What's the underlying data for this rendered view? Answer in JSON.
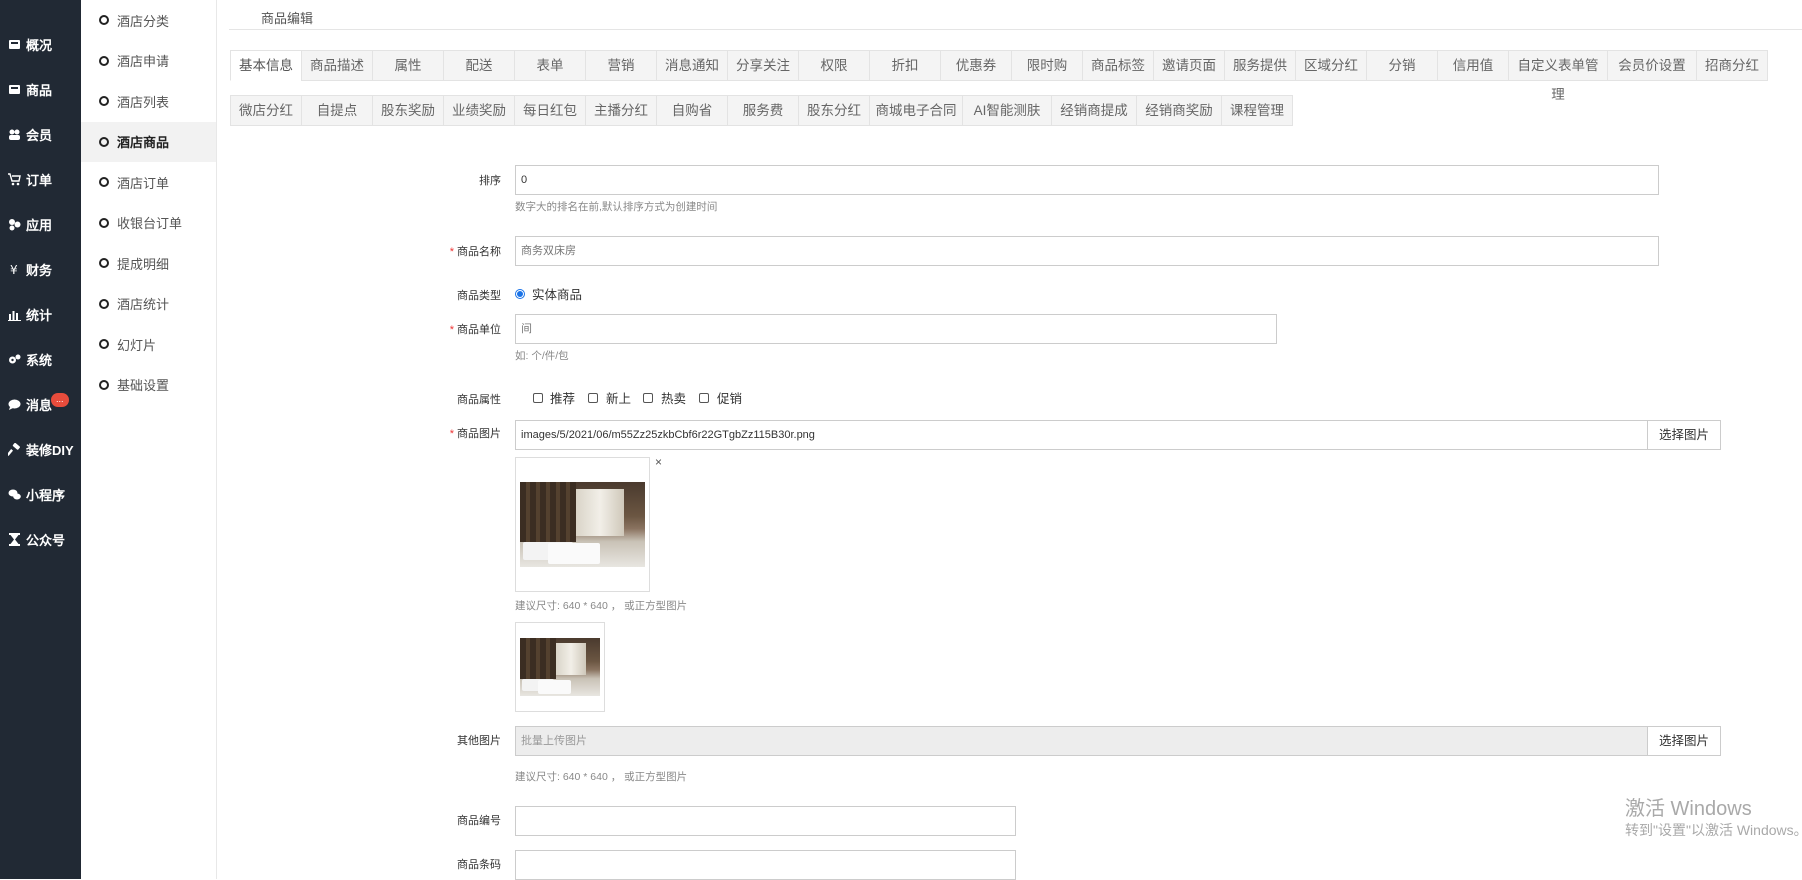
{
  "nav": {
    "items": [
      {
        "label": "概况",
        "icon": "dashboard-icon"
      },
      {
        "label": "商品",
        "icon": "product-icon"
      },
      {
        "label": "会员",
        "icon": "users-icon"
      },
      {
        "label": "订单",
        "icon": "cart-icon"
      },
      {
        "label": "应用",
        "icon": "apps-icon"
      },
      {
        "label": "财务",
        "icon": "yen-icon"
      },
      {
        "label": "统计",
        "icon": "bar-chart-icon"
      },
      {
        "label": "系统",
        "icon": "gears-icon"
      },
      {
        "label": "消息",
        "icon": "chat-icon",
        "badge": "..."
      },
      {
        "label": "装修DIY",
        "icon": "hammer-icon"
      },
      {
        "label": "小程序",
        "icon": "wechat-icon"
      },
      {
        "label": "公众号",
        "icon": "hourglass-icon"
      }
    ]
  },
  "subnav": {
    "items": [
      "酒店分类",
      "酒店申请",
      "酒店列表",
      "酒店商品",
      "酒店订单",
      "收银台订单",
      "提成明细",
      "酒店统计",
      "幻灯片",
      "基础设置"
    ],
    "active_index": 3
  },
  "page": {
    "title": "商品编辑"
  },
  "tabs": {
    "row1": [
      "基本信息",
      "商品描述",
      "属性",
      "配送",
      "表单",
      "营销",
      "消息通知",
      "分享关注",
      "权限",
      "折扣",
      "优惠券",
      "限时购",
      "商品标签",
      "邀请页面",
      "服务提供",
      "区域分红",
      "分销",
      "信用值",
      "自定义表单管理",
      "会员价设置",
      "招商分红"
    ],
    "row2": [
      "微店分红",
      "自提点",
      "股东奖励",
      "业绩奖励",
      "每日红包",
      "主播分红",
      "自购省",
      "服务费",
      "股东分红",
      "商城电子合同",
      "AI智能测肤",
      "经销商提成",
      "经销商奖励",
      "课程管理"
    ],
    "active": "基本信息"
  },
  "form": {
    "sort": {
      "label": "排序",
      "value": "0",
      "help": "数字大的排名在前,默认排序方式为创建时间"
    },
    "name": {
      "label": "商品名称",
      "value": "商务双床房",
      "required": true
    },
    "type": {
      "label": "商品类型",
      "option": "实体商品",
      "checked": true
    },
    "unit": {
      "label": "商品单位",
      "value": "间",
      "required": true,
      "help": "如: 个/件/包"
    },
    "attrs": {
      "label": "商品属性",
      "options": [
        "推荐",
        "新上",
        "热卖",
        "促销"
      ]
    },
    "image": {
      "label": "商品图片",
      "value": "images/5/2021/06/m55Zz25zkbCbf6r22GTgbZz115B30r.png",
      "required": true,
      "button": "选择图片",
      "close": "×",
      "help": "建议尺寸: 640 * 640 ， 或正方型图片"
    },
    "other_images": {
      "label": "其他图片",
      "placeholder": "批量上传图片",
      "button": "选择图片",
      "help": "建议尺寸: 640 * 640 ， 或正方型图片"
    },
    "code": {
      "label": "商品编号",
      "value": ""
    },
    "barcode": {
      "label": "商品条码",
      "value": ""
    }
  },
  "watermark": {
    "line1": "激活 Windows",
    "line2": "转到\"设置\"以激活 Windows。"
  }
}
